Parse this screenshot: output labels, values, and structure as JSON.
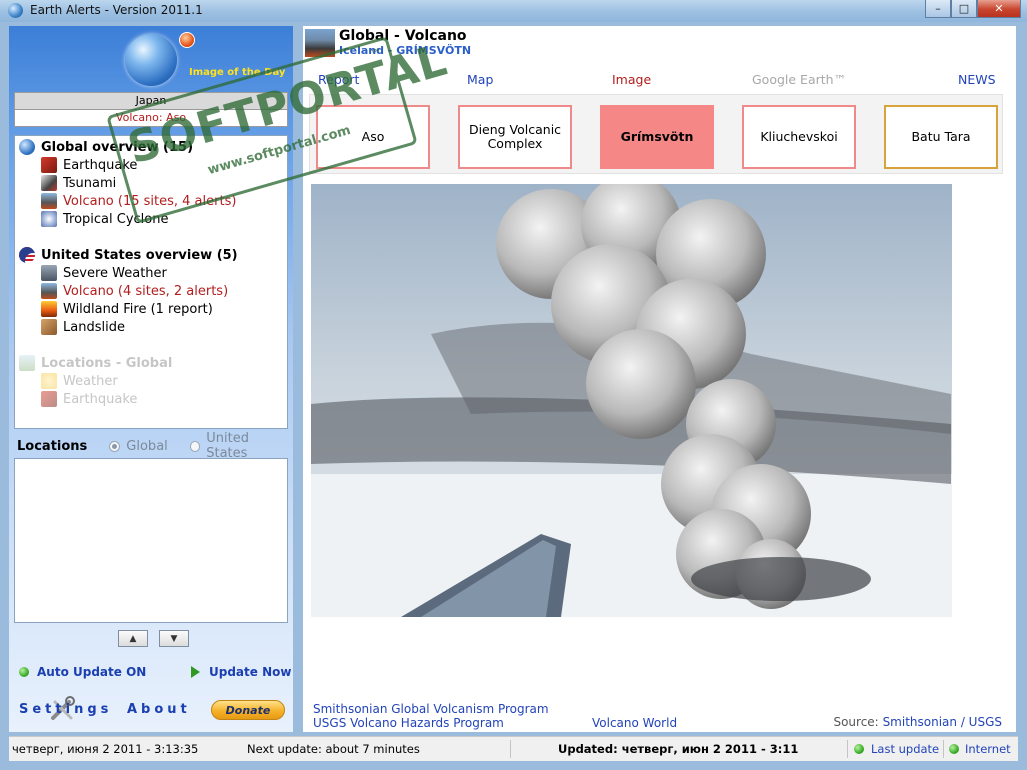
{
  "window": {
    "title": "Earth Alerts - Version 2011.1",
    "min": "–",
    "max": "□",
    "close": "✕"
  },
  "sidebar": {
    "image_of_the_day": "Image of the Day",
    "iotd_country": "Japan",
    "iotd_event": "Volcano: Aso",
    "tree": {
      "global_header": "Global overview (15)",
      "global_items": [
        {
          "label": "Earthquake",
          "style": "normal"
        },
        {
          "label": "Tsunami",
          "style": "normal"
        },
        {
          "label": "Volcano (15 sites, 4 alerts)",
          "style": "alert"
        },
        {
          "label": "Tropical Cyclone",
          "style": "normal"
        }
      ],
      "us_header": "United States overview (5)",
      "us_items": [
        {
          "label": "Severe Weather",
          "style": "normal"
        },
        {
          "label": "Volcano (4 sites, 2 alerts)",
          "style": "alert"
        },
        {
          "label": "Wildland Fire (1 report)",
          "style": "normal"
        },
        {
          "label": "Landslide",
          "style": "normal"
        }
      ],
      "locations_header": "Locations - Global",
      "locations_items": [
        {
          "label": "Weather",
          "style": "disabled"
        },
        {
          "label": "Earthquake",
          "style": "disabled"
        }
      ]
    },
    "locations_label": "Locations",
    "radio_global": "Global",
    "radio_us": "United States",
    "radio_selected": "Global",
    "auto_update": "Auto Update ON",
    "update_now": "Update Now",
    "settings": "Settings",
    "about": "About",
    "donate": "Donate",
    "up_arrow": "▲",
    "down_arrow": "▼"
  },
  "main": {
    "title": "Global - Volcano",
    "subtitle": "Iceland - GRÍMSVÖTN",
    "tabs": [
      "Report",
      "Map",
      "Image",
      "Google Earth™",
      "NEWS"
    ],
    "active_tab": "Image",
    "volcanoes": [
      {
        "name": "Aso",
        "state": "normal"
      },
      {
        "name": "Dieng Volcanic Complex",
        "state": "normal"
      },
      {
        "name": "Grímsvötn",
        "state": "selected"
      },
      {
        "name": "Kliuchevskoi",
        "state": "normal"
      },
      {
        "name": "Batu Tara",
        "state": "warning"
      }
    ],
    "links": [
      "Smithsonian Global Volcanism Program",
      "USGS Volcano Hazards Program",
      "Volcano World"
    ],
    "source_label": "Source:",
    "source_value": "Smithsonian / USGS"
  },
  "watermark": {
    "text": "SOFTPORTAL",
    "url": "www.softportal.com",
    "tm": "™"
  },
  "status": {
    "now": "четверг, июня 2 2011 - 3:13:35",
    "next_update": "Next update: about 7 minutes",
    "updated": "Updated: четверг, июн 2 2011 - 3:11",
    "last_update": "Last update",
    "internet": "Internet"
  },
  "colors": {
    "alert": "#b21d1d",
    "selected_volcano": "#f58787",
    "link": "#2244b8"
  }
}
